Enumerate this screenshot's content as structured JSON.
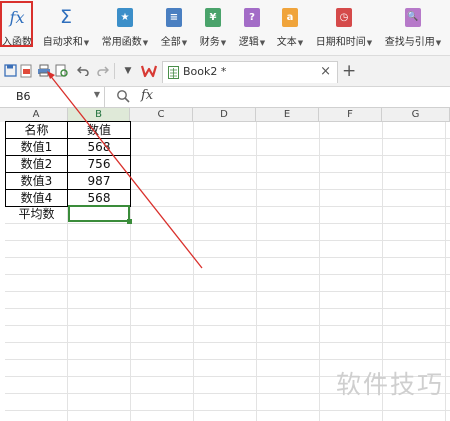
{
  "ribbon": {
    "insert_function": {
      "glyph": "fx",
      "label": "入函数"
    },
    "autosum": {
      "glyph": "Σ",
      "label": "自动求和"
    },
    "common": {
      "glyph": "★",
      "label": "常用函数",
      "color": "#3c8fc9"
    },
    "all": {
      "glyph": "≡",
      "label": "全部",
      "color": "#4a7fc1"
    },
    "finance": {
      "glyph": "¥",
      "label": "财务",
      "color": "#4aa36b"
    },
    "logic": {
      "glyph": "?",
      "label": "逻辑",
      "color": "#a36cc7"
    },
    "text": {
      "glyph": "a",
      "label": "文本",
      "color": "#f0a43b"
    },
    "datetime": {
      "glyph": "◷",
      "label": "日期和时间",
      "color": "#d54a4a"
    },
    "lookup": {
      "glyph": "🔍",
      "label": "查找与引用",
      "color": "#b679c9"
    },
    "highlight_color": "#d9302c"
  },
  "toolbar": {
    "icons": [
      "save-icon",
      "export-pdf-icon",
      "print-icon",
      "print-preview-icon",
      "undo-icon",
      "redo-icon",
      "dropdown-icon"
    ],
    "doc_tab": {
      "name": "Book2 *",
      "close": "×"
    },
    "new_tab": "+"
  },
  "formula_bar": {
    "cell_ref": "B6",
    "fx": "fx",
    "content": ""
  },
  "sheet": {
    "columns": [
      "A",
      "B",
      "C",
      "D",
      "E",
      "F",
      "G"
    ],
    "selected_column": "B",
    "rows": [
      [
        "名称",
        "数值"
      ],
      [
        "数值1",
        "568"
      ],
      [
        "数值2",
        "756"
      ],
      [
        "数值3",
        "987"
      ],
      [
        "数值4",
        "568"
      ],
      [
        "平均数",
        ""
      ]
    ],
    "selected_cell": "B6"
  },
  "watermark": "软件技巧"
}
